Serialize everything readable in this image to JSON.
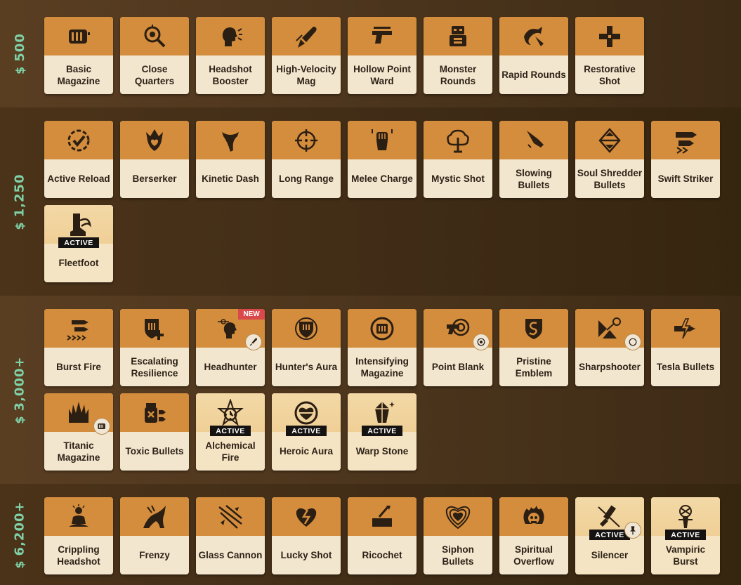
{
  "currency_icon": "souls-icon",
  "colors": {
    "tier_text": "#7fd2a8",
    "card_top": "#d48d3d",
    "card_body": "#f2e6cf",
    "active_badge": "#151311",
    "new_badge": "#d9484a"
  },
  "tiers": [
    {
      "price": "500",
      "items": [
        {
          "label": "Basic Magazine",
          "icon": "magazine-icon"
        },
        {
          "label": "Close Quarters",
          "icon": "magnifier-target-icon"
        },
        {
          "label": "Headshot Booster",
          "icon": "head-burst-icon"
        },
        {
          "label": "High-Velocity Mag",
          "icon": "bullet-streak-icon"
        },
        {
          "label": "Hollow Point Ward",
          "icon": "pistol-icon"
        },
        {
          "label": "Monster Rounds",
          "icon": "robot-icon"
        },
        {
          "label": "Rapid Rounds",
          "icon": "swirl-bullet-icon"
        },
        {
          "label": "Restorative Shot",
          "icon": "plus-cross-icon"
        }
      ]
    },
    {
      "price": "1,250",
      "items": [
        {
          "label": "Active Reload",
          "icon": "reload-check-icon"
        },
        {
          "label": "Berserker",
          "icon": "heart-flame-icon"
        },
        {
          "label": "Kinetic Dash",
          "icon": "scarf-icon"
        },
        {
          "label": "Long Range",
          "icon": "crosshair-icon"
        },
        {
          "label": "Melee Charge",
          "icon": "fist-icon"
        },
        {
          "label": "Mystic Shot",
          "icon": "mystic-tree-icon"
        },
        {
          "label": "Slowing Bullets",
          "icon": "snail-bullet-icon"
        },
        {
          "label": "Soul Shredder Bullets",
          "icon": "diamond-arrows-icon"
        },
        {
          "label": "Swift Striker",
          "icon": "speed-bullets-icon"
        },
        {
          "label": "Fleetfoot",
          "icon": "boot-wing-icon",
          "active": "ACTIVE"
        }
      ]
    },
    {
      "price": "3,000+",
      "items": [
        {
          "label": "Burst Fire",
          "icon": "burst-bullets-icon"
        },
        {
          "label": "Escalating Resilience",
          "icon": "shield-plus-icon"
        },
        {
          "label": "Headhunter",
          "icon": "head-target-icon",
          "new": "NEW",
          "sub": "bullet-sub-icon"
        },
        {
          "label": "Hunter's Aura",
          "icon": "aura-shield-icon"
        },
        {
          "label": "Intensifying Magazine",
          "icon": "mag-cycle-icon"
        },
        {
          "label": "Point Blank",
          "icon": "gun-target-icon",
          "sub": "target-sub-icon"
        },
        {
          "label": "Pristine Emblem",
          "icon": "emblem-icon"
        },
        {
          "label": "Sharpshooter",
          "icon": "sharpshooter-icon",
          "sub": "circle-sub-icon"
        },
        {
          "label": "Tesla Bullets",
          "icon": "tesla-bullet-icon"
        },
        {
          "label": "Titanic Magazine",
          "icon": "titan-crown-icon",
          "sub": "magazine-sub-icon"
        },
        {
          "label": "Toxic Bullets",
          "icon": "toxic-flask-icon"
        },
        {
          "label": "Alchemical Fire",
          "icon": "alchemy-clock-icon",
          "active": "ACTIVE"
        },
        {
          "label": "Heroic Aura",
          "icon": "heart-ring-icon",
          "active": "ACTIVE"
        },
        {
          "label": "Warp Stone",
          "icon": "crystal-icon",
          "active": "ACTIVE"
        }
      ]
    },
    {
      "price": "6,200+",
      "items": [
        {
          "label": "Crippling Headshot",
          "icon": "meditating-figure-icon"
        },
        {
          "label": "Frenzy",
          "icon": "frenzy-icon"
        },
        {
          "label": "Glass Cannon",
          "icon": "shattered-glass-icon"
        },
        {
          "label": "Lucky Shot",
          "icon": "broken-heart-icon"
        },
        {
          "label": "Ricochet",
          "icon": "ricochet-icon"
        },
        {
          "label": "Siphon Bullets",
          "icon": "layered-heart-icon"
        },
        {
          "label": "Spiritual Overflow",
          "icon": "skull-flame-icon"
        },
        {
          "label": "Silencer",
          "icon": "silencer-icon",
          "active": "ACTIVE",
          "sub": "pin-sub-icon"
        },
        {
          "label": "Vampiric Burst",
          "icon": "vampire-totem-icon",
          "active": "ACTIVE"
        }
      ]
    }
  ]
}
